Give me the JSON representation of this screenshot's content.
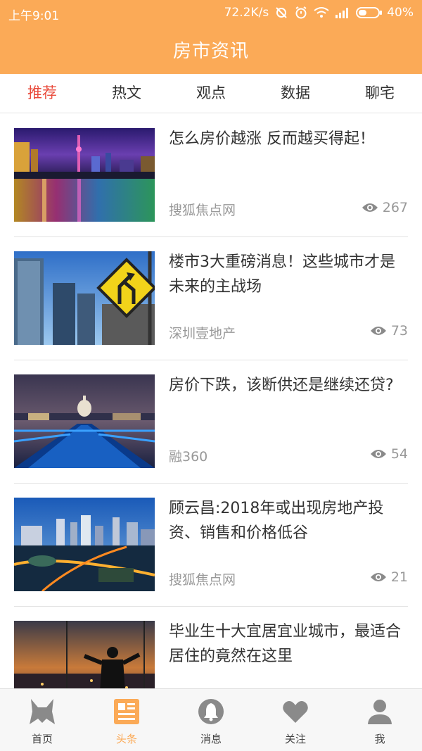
{
  "status_bar": {
    "time": "上午9:01",
    "speed": "72.2K/s",
    "battery": "40%"
  },
  "header": {
    "title": "房市资讯"
  },
  "tabs": [
    {
      "label": "推荐",
      "active": true
    },
    {
      "label": "热文",
      "active": false
    },
    {
      "label": "观点",
      "active": false
    },
    {
      "label": "数据",
      "active": false
    },
    {
      "label": "聊宅",
      "active": false
    }
  ],
  "articles": [
    {
      "title": "怎么房价越涨 反而越买得起！",
      "source": "搜狐焦点网",
      "views": "267",
      "image": "city-night-river"
    },
    {
      "title": "楼市3大重磅消息！这些城市才是未来的主战场",
      "source": "深圳壹地产",
      "views": "73",
      "image": "skyscrapers-road-sign"
    },
    {
      "title": "房价下跌，该断供还是继续还贷?",
      "source": "融360",
      "views": "54",
      "image": "london-night-bridge"
    },
    {
      "title": "顾云昌:2018年或出现房地产投资、销售和价格低谷",
      "source": "搜狐焦点网",
      "views": "21",
      "image": "city-aerial-dusk"
    },
    {
      "title": "毕业生十大宜居宜业城市，最适合居住的竟然在这里",
      "source": "",
      "views": "",
      "image": "man-overlooking-city"
    }
  ],
  "bottom_nav": [
    {
      "label": "首页",
      "icon": "home-icon",
      "active": false
    },
    {
      "label": "头条",
      "icon": "headlines-icon",
      "active": true
    },
    {
      "label": "消息",
      "icon": "bell-icon",
      "active": false
    },
    {
      "label": "关注",
      "icon": "heart-icon",
      "active": false
    },
    {
      "label": "我",
      "icon": "user-icon",
      "active": false
    }
  ],
  "colors": {
    "header_bg": "#FBAA57",
    "active_tab": "#E94B3C",
    "active_nav": "#FBAA57"
  }
}
